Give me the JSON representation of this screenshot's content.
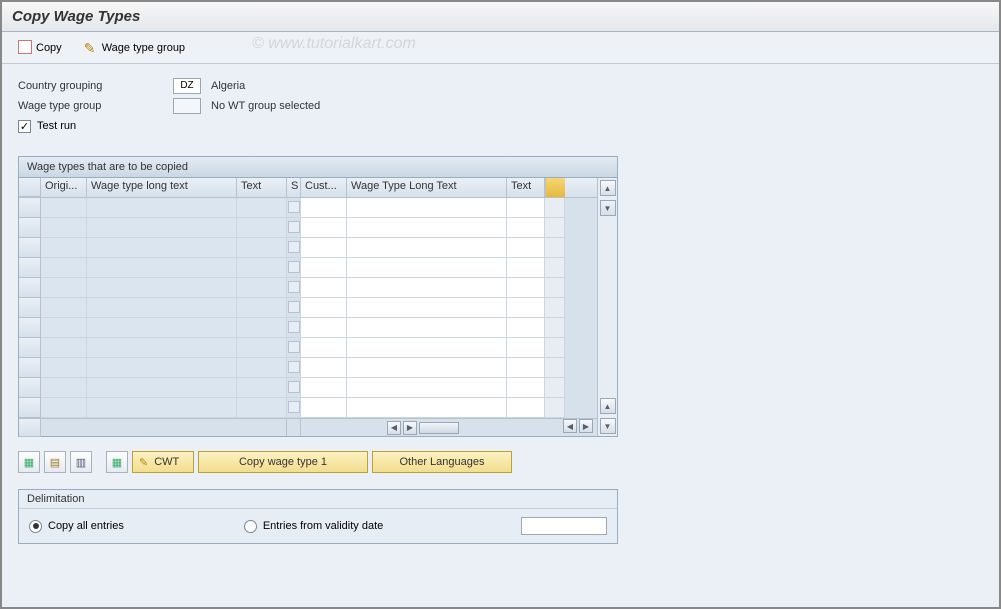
{
  "title": "Copy Wage Types",
  "watermark": "©  www.tutorialkart.com",
  "toolbar": {
    "copy_label": "Copy",
    "wage_type_group_label": "Wage type group"
  },
  "fields": {
    "country_grouping": {
      "label": "Country grouping",
      "value": "DZ",
      "text": "Algeria"
    },
    "wage_type_group": {
      "label": "Wage type group",
      "value": "",
      "text": "No WT group selected"
    },
    "test_run": {
      "label": "Test run",
      "checked": true
    }
  },
  "grid": {
    "title": "Wage types that are to be copied",
    "columns": {
      "origi": "Origi...",
      "long_l": "Wage type long text",
      "text_l": "Text",
      "s": "S",
      "cust": "Cust...",
      "long_r": "Wage Type Long Text",
      "text_r": "Text"
    },
    "row_count": 11
  },
  "buttons": {
    "cwt": "CWT",
    "copy_wage_type_1": "Copy wage type 1",
    "other_languages": "Other Languages"
  },
  "delimitation": {
    "title": "Delimitation",
    "copy_all": "Copy all entries",
    "entries_from": "Entries from validity date",
    "selected": "copy_all",
    "date_value": ""
  }
}
